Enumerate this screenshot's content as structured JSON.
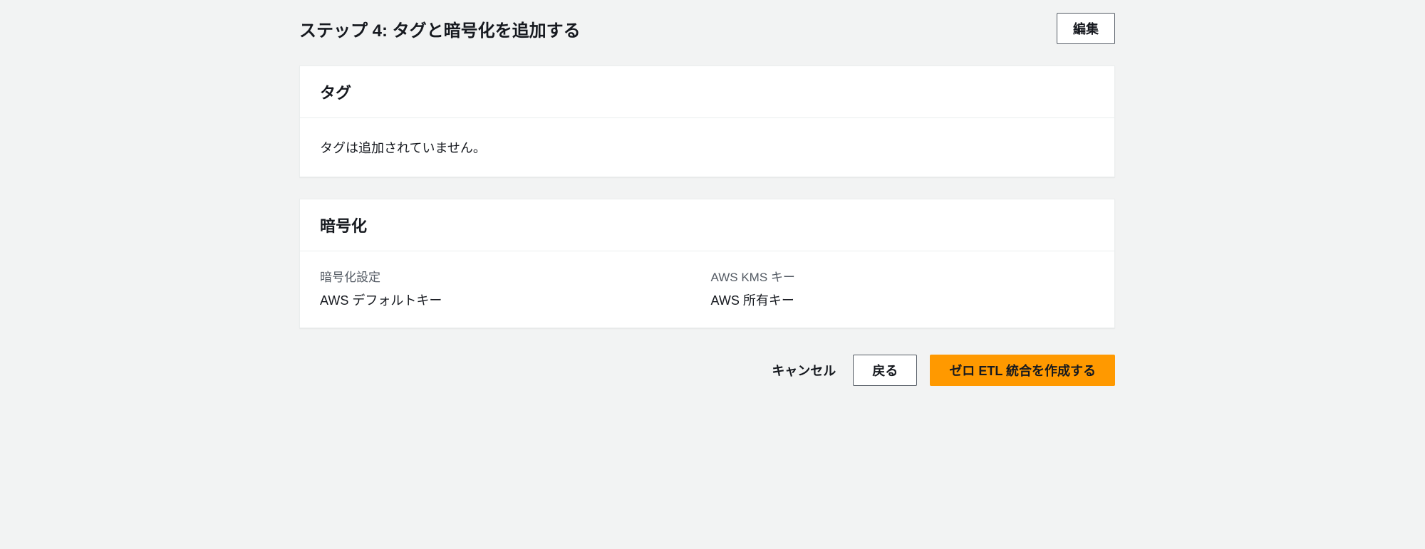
{
  "step": {
    "title": "ステップ 4: タグと暗号化を追加する",
    "edit_label": "編集"
  },
  "tags_panel": {
    "title": "タグ",
    "empty_text": "タグは追加されていません。"
  },
  "encryption_panel": {
    "title": "暗号化",
    "fields": [
      {
        "label": "暗号化設定",
        "value": "AWS デフォルトキー"
      },
      {
        "label": "AWS KMS キー",
        "value": "AWS 所有キー"
      }
    ]
  },
  "footer": {
    "cancel": "キャンセル",
    "back": "戻る",
    "create": "ゼロ ETL 統合を作成する"
  }
}
